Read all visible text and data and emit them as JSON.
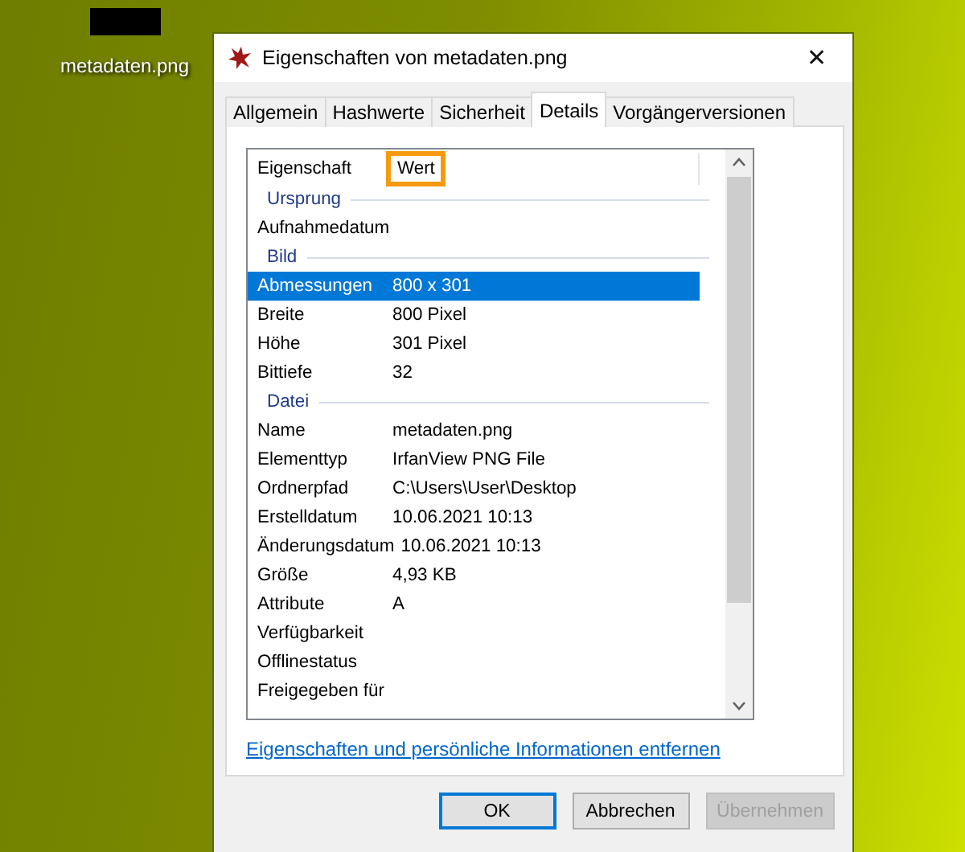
{
  "desktop_icon": {
    "label": "metadaten.png"
  },
  "window": {
    "title": "Eigenschaften von metadaten.png",
    "close": "✕"
  },
  "tabs": [
    {
      "label": "Allgemein",
      "selected": false
    },
    {
      "label": "Hashwerte",
      "selected": false
    },
    {
      "label": "Sicherheit",
      "selected": false
    },
    {
      "label": "Details",
      "selected": true
    },
    {
      "label": "Vorgängerversionen",
      "selected": false
    }
  ],
  "list": {
    "columns": [
      {
        "label": "Eigenschaft",
        "highlighted": false
      },
      {
        "label": "Wert",
        "highlighted": true
      }
    ],
    "groups": [
      {
        "title": "Ursprung",
        "rows": [
          {
            "property": "Aufnahmedatum",
            "value": "",
            "selected": false
          }
        ]
      },
      {
        "title": "Bild",
        "rows": [
          {
            "property": "Abmessungen",
            "value": "800 x 301",
            "selected": true
          },
          {
            "property": "Breite",
            "value": "800 Pixel",
            "selected": false
          },
          {
            "property": "Höhe",
            "value": "301 Pixel",
            "selected": false
          },
          {
            "property": "Bittiefe",
            "value": "32",
            "selected": false
          }
        ]
      },
      {
        "title": "Datei",
        "rows": [
          {
            "property": "Name",
            "value": "metadaten.png",
            "selected": false
          },
          {
            "property": "Elementtyp",
            "value": "IrfanView PNG File",
            "selected": false
          },
          {
            "property": "Ordnerpfad",
            "value": "C:\\Users\\User\\Desktop",
            "selected": false
          },
          {
            "property": "Erstelldatum",
            "value": "10.06.2021 10:13",
            "selected": false
          },
          {
            "property": "Änderungsdatum",
            "value": "10.06.2021 10:13",
            "selected": false
          },
          {
            "property": "Größe",
            "value": "4,93 KB",
            "selected": false
          },
          {
            "property": "Attribute",
            "value": "A",
            "selected": false
          },
          {
            "property": "Verfügbarkeit",
            "value": "",
            "selected": false
          },
          {
            "property": "Offlinestatus",
            "value": "",
            "selected": false
          },
          {
            "property": "Freigegeben für",
            "value": "",
            "selected": false
          }
        ]
      }
    ]
  },
  "link": "Eigenschaften und persönliche Informationen entfernen",
  "buttons": [
    {
      "label": "OK",
      "default": true,
      "disabled": false
    },
    {
      "label": "Abbrechen",
      "default": false,
      "disabled": false
    },
    {
      "label": "Übernehmen",
      "default": false,
      "disabled": true
    }
  ]
}
